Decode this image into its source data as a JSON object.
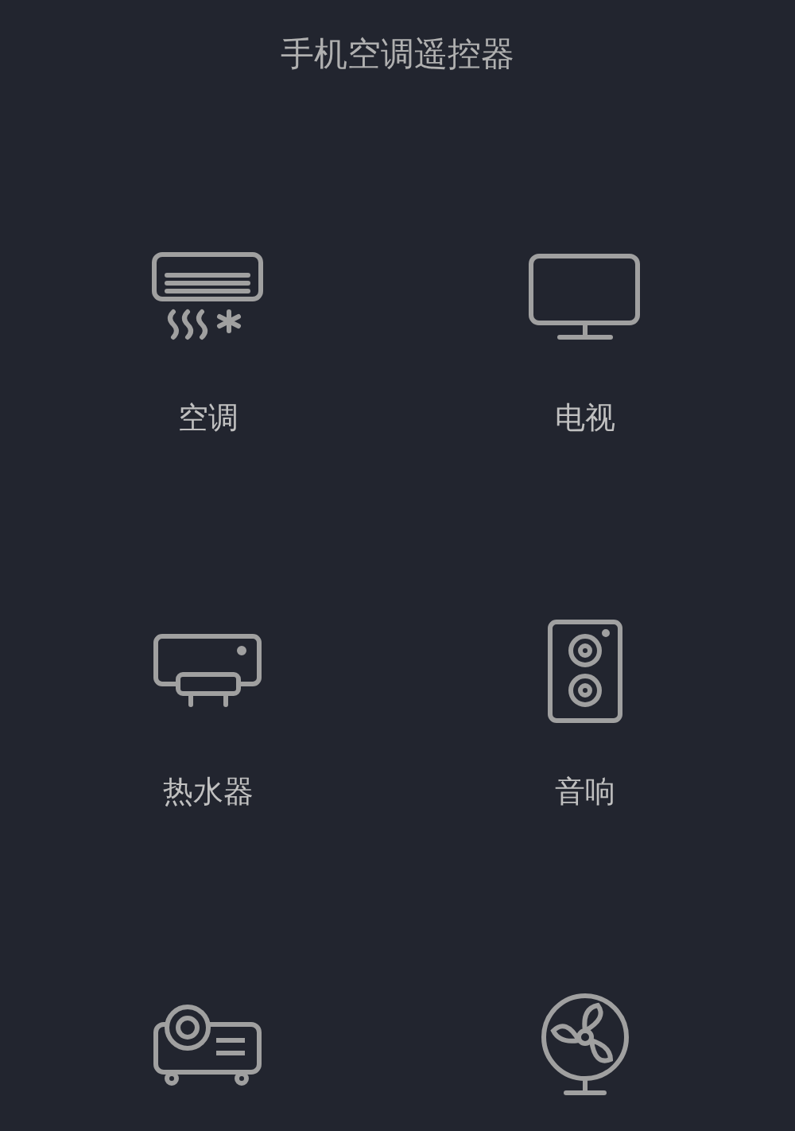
{
  "title": "手机空调遥控器",
  "devices": [
    {
      "kind": "air-conditioner",
      "label": "空调"
    },
    {
      "kind": "tv",
      "label": "电视"
    },
    {
      "kind": "water-heater",
      "label": "热水器"
    },
    {
      "kind": "speaker",
      "label": "音响"
    },
    {
      "kind": "projector"
    },
    {
      "kind": "fan"
    }
  ]
}
